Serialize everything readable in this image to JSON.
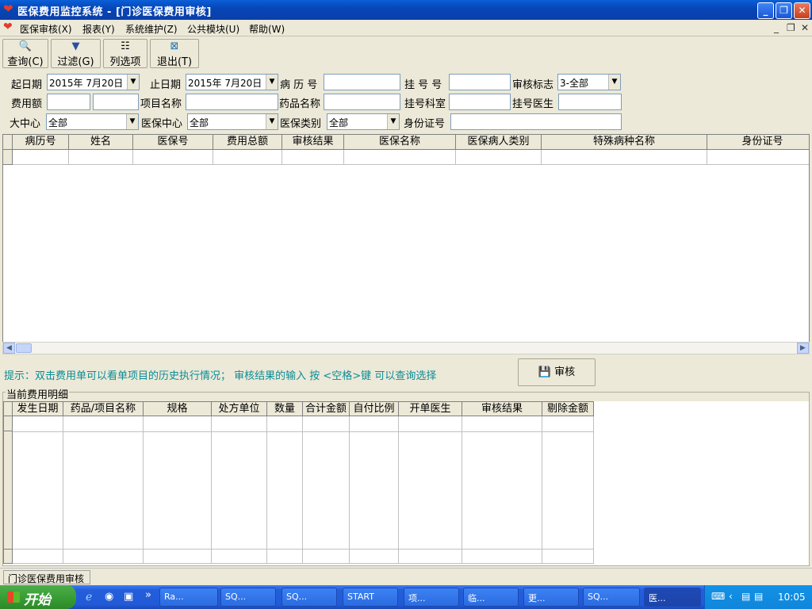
{
  "window": {
    "title": "医保费用监控系统 - [门诊医保费用审核]",
    "controls": [
      "_",
      "❐",
      "✕"
    ]
  },
  "menu": {
    "items": [
      "医保审核(X)",
      "报表(Y)",
      "系统维护(Z)",
      "公共模块(U)",
      "帮助(W)"
    ],
    "mdi_controls": [
      "_",
      "❐",
      "✕"
    ]
  },
  "toolbar": {
    "buttons": [
      {
        "label": "查询(C)",
        "icon": "search-icon"
      },
      {
        "label": "过滤(G)",
        "icon": "filter-icon"
      },
      {
        "label": "列选项",
        "icon": "columns-icon"
      },
      {
        "label": "退出(T)",
        "icon": "exit-icon"
      }
    ]
  },
  "filters": {
    "start_date_label": "起日期",
    "start_date_value": "2015年 7月20日",
    "end_date_label": "止日期",
    "end_date_value": "2015年 7月20日",
    "case_no_label": "病 历 号",
    "case_no_value": "",
    "reg_no_label": "挂 号 号",
    "reg_no_value": "",
    "audit_flag_label": "审核标志",
    "audit_flag_value": "3-全部",
    "amount_label": "费用额",
    "amount_from": "",
    "amount_to": "",
    "item_name_label": "项目名称",
    "item_name_value": "",
    "drug_name_label": "药品名称",
    "drug_name_value": "",
    "reg_dept_label": "挂号科室",
    "reg_dept_value": "",
    "reg_doctor_label": "挂号医生",
    "reg_doctor_value": "",
    "center_label": "大中心",
    "center_value": "全部",
    "ins_center_label": "医保中心",
    "ins_center_value": "全部",
    "ins_type_label": "医保类别",
    "ins_type_value": "全部",
    "id_card_label": "身份证号",
    "id_card_value": ""
  },
  "main_table": {
    "columns": [
      "病历号",
      "姓名",
      "医保号",
      "费用总额",
      "审核结果",
      "医保名称",
      "医保病人类别",
      "特殊病种名称",
      "身份证号"
    ],
    "rows": []
  },
  "hint": "提示：双击费用单可以看单项目的历史执行情况；    审核结果的输入    按 <空格>键 可以查询选择",
  "audit_button": "审核",
  "detail_section_title": "当前费用明细",
  "detail_table": {
    "columns": [
      "发生日期",
      "药品/项目名称",
      "规格",
      "处方单位",
      "数量",
      "合计金额",
      "自付比例",
      "开单医生",
      "审核结果",
      "剔除金额"
    ],
    "rows": []
  },
  "status": {
    "panel": "门诊医保费用审核"
  },
  "taskbar": {
    "start": "开始",
    "quicklaunch_more": "»",
    "tasks": [
      "Ra...",
      "SQ...",
      "SQ...",
      "START",
      "项...",
      "临...",
      "更...",
      "SQ...",
      "医..."
    ],
    "clock": "10:05"
  }
}
